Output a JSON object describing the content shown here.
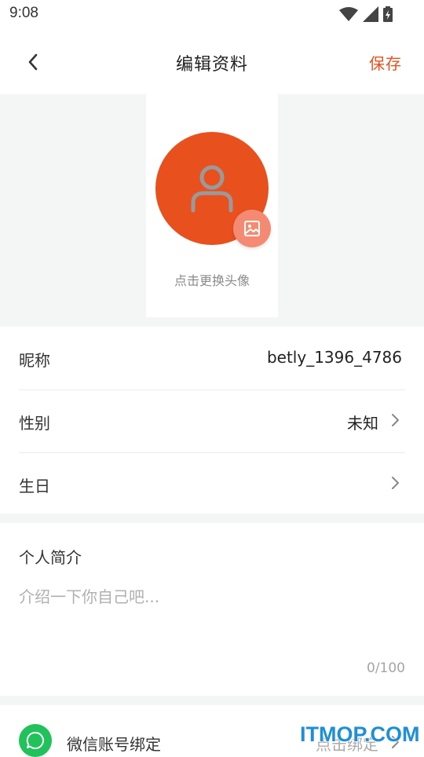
{
  "status_bar": {
    "time": "9:08",
    "icons": [
      "wifi-icon",
      "signal-icon",
      "battery-icon"
    ]
  },
  "header": {
    "back_icon": "chevron-left-icon",
    "title": "编辑资料",
    "save_label": "保存"
  },
  "avatar": {
    "placeholder_icon": "user-icon",
    "change_icon": "image-icon",
    "caption": "点击更换头像"
  },
  "fields": {
    "nickname": {
      "label": "昵称",
      "value": "betly_1396_4786"
    },
    "gender": {
      "label": "性别",
      "value": "未知"
    },
    "birthday": {
      "label": "生日",
      "value": ""
    }
  },
  "bio": {
    "title": "个人简介",
    "placeholder": "介绍一下你自己吧...",
    "counter": "0/100"
  },
  "wechat": {
    "icon": "wechat-icon",
    "label": "微信账号绑定",
    "action": "点击绑定"
  },
  "watermark": "ITMOP.COM",
  "colors": {
    "accent": "#E8501E",
    "avatar_badge": "#F58A73",
    "wechat_green": "#21C15B",
    "band_gray": "#F4F5F5",
    "watermark_blue": "#1D8FD4"
  }
}
